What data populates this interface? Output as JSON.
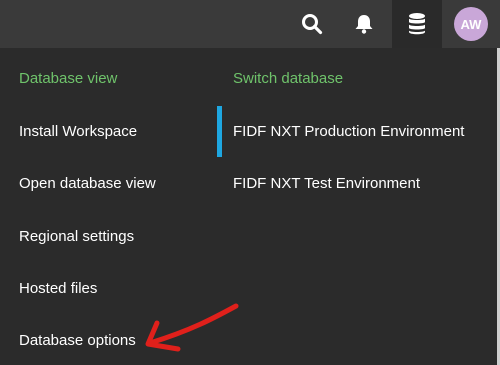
{
  "topbar": {
    "icons": [
      "search-icon",
      "bell-icon",
      "database-icon"
    ],
    "avatar_initials": "AW",
    "avatar_color": "#c9a7d8"
  },
  "menu": {
    "left": {
      "heading": "Database view",
      "items": [
        "Install Workspace",
        "Open database view",
        "Regional settings",
        "Hosted files",
        "Database options"
      ]
    },
    "right": {
      "heading": "Switch database",
      "items": [
        "FIDF NXT Production Environment",
        "FIDF NXT Test Environment"
      ],
      "active_index": 0
    }
  },
  "colors": {
    "heading": "#6fc36b",
    "active": "#1ea7e1",
    "annotation": "#e0201b"
  }
}
